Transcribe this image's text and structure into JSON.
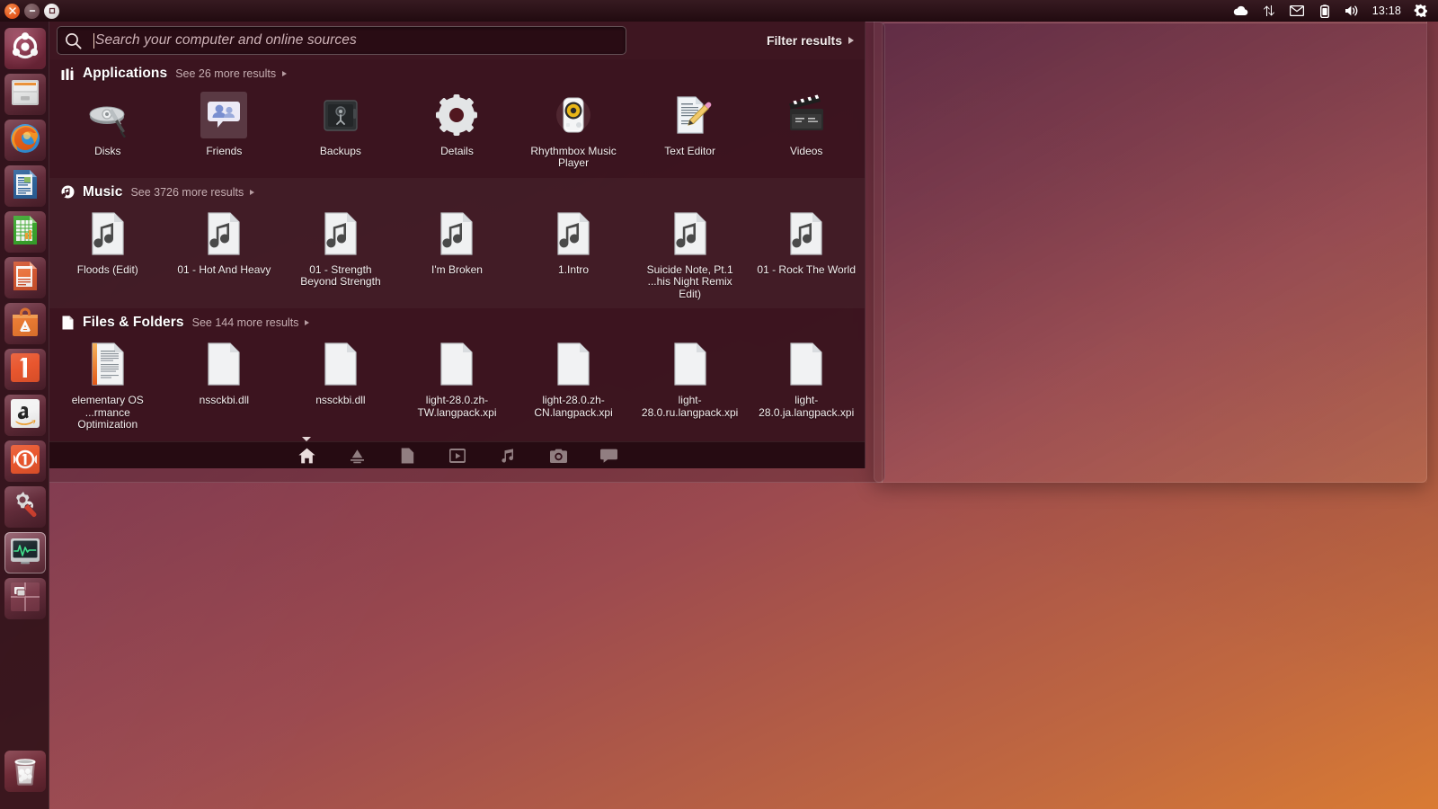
{
  "panel": {
    "window_controls": [
      {
        "name": "close",
        "label": "Close"
      },
      {
        "name": "minimize",
        "label": "Minimize"
      },
      {
        "name": "maximize",
        "label": "Maximize"
      }
    ],
    "tray_icons": [
      "cloud-icon",
      "network-icon",
      "mail-icon",
      "battery-icon",
      "volume-icon",
      "power-gear-icon"
    ],
    "clock": "13:18"
  },
  "launcher": {
    "items": [
      {
        "name": "dash-home",
        "label": "Ubuntu Dash Home",
        "icon": "ubuntu-logo-icon",
        "running": true,
        "focused": false
      },
      {
        "name": "files",
        "label": "Files",
        "icon": "file-cabinet-icon",
        "running": false,
        "focused": false
      },
      {
        "name": "firefox",
        "label": "Firefox Web Browser",
        "icon": "firefox-icon",
        "running": false,
        "focused": false
      },
      {
        "name": "writer",
        "label": "LibreOffice Writer",
        "icon": "writer-icon",
        "running": false,
        "focused": false
      },
      {
        "name": "calc",
        "label": "LibreOffice Calc",
        "icon": "calc-icon",
        "running": false,
        "focused": false
      },
      {
        "name": "impress",
        "label": "LibreOffice Impress",
        "icon": "impress-icon",
        "running": false,
        "focused": false
      },
      {
        "name": "software-center",
        "label": "Ubuntu Software Center",
        "icon": "software-bag-icon",
        "running": false,
        "focused": false
      },
      {
        "name": "ubuntu-one",
        "label": "Ubuntu One",
        "icon": "ubuntu-one-icon",
        "running": false,
        "focused": false
      },
      {
        "name": "amazon",
        "label": "Amazon",
        "icon": "amazon-icon",
        "running": false,
        "focused": false
      },
      {
        "name": "ubuntu-one-music",
        "label": "Ubuntu One Music",
        "icon": "headphones-icon",
        "running": false,
        "focused": false
      },
      {
        "name": "system-settings",
        "label": "System Settings",
        "icon": "gear-wrench-icon",
        "running": false,
        "focused": false
      },
      {
        "name": "system-monitor",
        "label": "System Monitor",
        "icon": "monitor-graph-icon",
        "running": true,
        "focused": true
      },
      {
        "name": "workspace-switcher",
        "label": "Workspace Switcher",
        "icon": "workspaces-icon",
        "running": false,
        "focused": false
      }
    ],
    "trash": {
      "name": "trash",
      "label": "Rubbish Bin",
      "icon": "trash-icon"
    }
  },
  "dash": {
    "search": {
      "placeholder": "Search your computer and online sources",
      "value": "",
      "icon": "search-icon"
    },
    "filter_button": "Filter results",
    "sections": [
      {
        "id": "applications",
        "title": "Applications",
        "icon": "applications-icon",
        "more_results": "See 26 more results",
        "items": [
          {
            "label": "Disks",
            "icon": "disks-icon",
            "selected": false
          },
          {
            "label": "Friends",
            "icon": "friends-icon",
            "selected": true
          },
          {
            "label": "Backups",
            "icon": "backups-safe-icon",
            "selected": false
          },
          {
            "label": "Details",
            "icon": "details-gear-icon",
            "selected": false
          },
          {
            "label": "Rhythmbox Music Player",
            "icon": "rhythmbox-icon",
            "selected": false
          },
          {
            "label": "Text Editor",
            "icon": "text-editor-icon",
            "selected": false
          },
          {
            "label": "Videos",
            "icon": "videos-clapper-icon",
            "selected": false
          }
        ]
      },
      {
        "id": "music",
        "title": "Music",
        "icon": "music-note-icon",
        "more_results": "See 3726 more results",
        "items": [
          {
            "label": "Floods (Edit)",
            "icon": "audio-file-icon",
            "selected": false
          },
          {
            "label": "01 - Hot And Heavy",
            "icon": "audio-file-icon",
            "selected": false
          },
          {
            "label": "01 - Strength Beyond Strength",
            "icon": "audio-file-icon",
            "selected": false
          },
          {
            "label": "I'm Broken",
            "icon": "audio-file-icon",
            "selected": false
          },
          {
            "label": "1.Intro",
            "icon": "audio-file-icon",
            "selected": false
          },
          {
            "label": "Suicide Note, Pt.1 ...his Night Remix Edit)",
            "icon": "audio-file-icon",
            "selected": false
          },
          {
            "label": "01 - Rock The World",
            "icon": "audio-file-icon",
            "selected": false
          }
        ]
      },
      {
        "id": "files-and-folders",
        "title": "Files & Folders",
        "icon": "document-icon",
        "more_results": "See 144 more results",
        "items": [
          {
            "label": "elementary OS ...rmance Optimization",
            "icon": "text-document-icon",
            "selected": false
          },
          {
            "label": "nssckbi.dll",
            "icon": "blank-document-icon",
            "selected": false
          },
          {
            "label": "nssckbi.dll",
            "icon": "blank-document-icon",
            "selected": false
          },
          {
            "label": "light-28.0.zh-TW.langpack.xpi",
            "icon": "blank-document-icon",
            "selected": false
          },
          {
            "label": "light-28.0.zh-CN.langpack.xpi",
            "icon": "blank-document-icon",
            "selected": false
          },
          {
            "label": "light-28.0.ru.langpack.xpi",
            "icon": "blank-document-icon",
            "selected": false
          },
          {
            "label": "light-28.0.ja.langpack.xpi",
            "icon": "blank-document-icon",
            "selected": false
          }
        ]
      }
    ],
    "lens_bar": [
      {
        "name": "lens-home",
        "icon": "home-icon",
        "active": true
      },
      {
        "name": "lens-applications",
        "icon": "applications-lens-icon",
        "active": false
      },
      {
        "name": "lens-files",
        "icon": "files-lens-icon",
        "active": false
      },
      {
        "name": "lens-video",
        "icon": "video-lens-icon",
        "active": false
      },
      {
        "name": "lens-music",
        "icon": "music-lens-icon",
        "active": false
      },
      {
        "name": "lens-photos",
        "icon": "photos-lens-icon",
        "active": false
      },
      {
        "name": "lens-messages",
        "icon": "messages-lens-icon",
        "active": false
      }
    ]
  },
  "colors": {
    "dash_background": "#3a141e",
    "panel": "#2c0e15",
    "accent_orange": "#e2541b",
    "text_primary": "#f4eeee",
    "text_muted": "#c6aeb2"
  }
}
